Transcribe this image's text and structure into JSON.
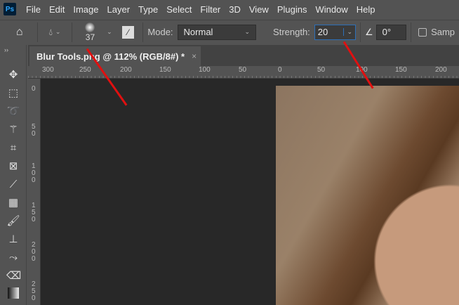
{
  "menubar": {
    "logo": "Ps",
    "items": [
      "File",
      "Edit",
      "Image",
      "Layer",
      "Type",
      "Select",
      "Filter",
      "3D",
      "View",
      "Plugins",
      "Window",
      "Help"
    ]
  },
  "options": {
    "brush_size": "37",
    "mode_label": "Mode:",
    "mode_value": "Normal",
    "strength_label": "Strength:",
    "strength_value": "20",
    "angle_value": "0°",
    "sample_label": "Samp"
  },
  "document": {
    "tab_title": "Blur Tools.png @ 112% (RGB/8#) *",
    "close": "×"
  },
  "rulers": {
    "horizontal": [
      "300",
      "250",
      "200",
      "150",
      "100",
      "50",
      "0",
      "50",
      "100",
      "150",
      "200"
    ],
    "vertical": [
      "0",
      "50",
      "100",
      "150",
      "200",
      "250"
    ]
  },
  "panel_toggle": "››",
  "colors": {
    "arrow": "#e01010",
    "accent": "#31a8ff"
  }
}
